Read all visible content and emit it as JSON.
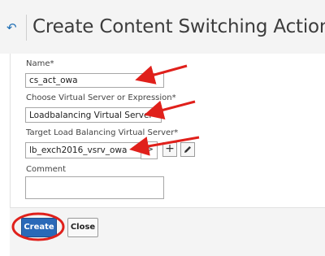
{
  "header": {
    "title": "Create Content Switching Action",
    "back_icon": "back-arrow-icon"
  },
  "form": {
    "name": {
      "label": "Name*",
      "value": "cs_act_owa"
    },
    "choose": {
      "label": "Choose Virtual Server or Expression*",
      "selected": "Loadbalancing Virtual Server"
    },
    "target": {
      "label": "Target Load Balancing Virtual Server*",
      "value": "lb_exch2016_vsrv_owa"
    },
    "comment": {
      "label": "Comment",
      "value": ""
    }
  },
  "buttons": {
    "create": "Create",
    "close": "Close",
    "add_symbol": "+",
    "arrow_symbol": ">"
  },
  "colors": {
    "accent": "#2a69b8",
    "annotation": "#e0201b"
  }
}
